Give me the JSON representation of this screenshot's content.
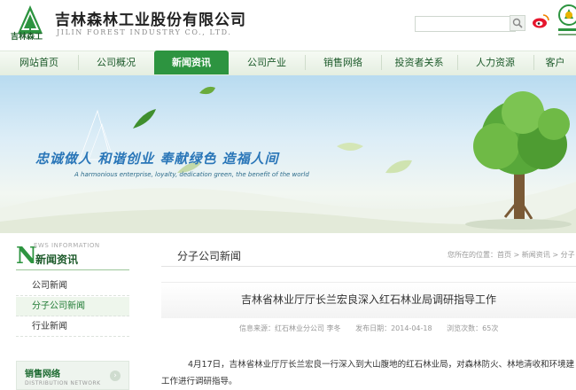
{
  "header": {
    "logo_caption": "吉林森工",
    "company_cn": "吉林森林工业股份有限公司",
    "company_en": "JILIN FOREST INDUSTRY CO., LTD.",
    "search_placeholder": ""
  },
  "nav": {
    "items": [
      {
        "label": "网站首页"
      },
      {
        "label": "公司概况"
      },
      {
        "label": "新闻资讯"
      },
      {
        "label": "公司产业"
      },
      {
        "label": "销售网络"
      },
      {
        "label": "投资者关系"
      },
      {
        "label": "人力资源"
      },
      {
        "label": "客户"
      }
    ],
    "active_index": 2
  },
  "banner": {
    "slogan_cn": "忠诚做人   和谐创业   奉献绿色   造福人间",
    "slogan_en": "A harmonious enterprise, loyalty, dedication green, the benefit of the world"
  },
  "sidebar": {
    "head_letter": "N",
    "head_en": "EWS INFORMATION",
    "title": "新闻资讯",
    "items": [
      {
        "label": "公司新闻"
      },
      {
        "label": "分子公司新闻"
      },
      {
        "label": "行业新闻"
      }
    ],
    "active_index": 1,
    "sales_cn": "销售网络",
    "sales_en": "DISTRIBUTION NETWORK"
  },
  "content": {
    "section_title": "分子公司新闻",
    "breadcrumb": "您所在的位置：首页 > 新闻资讯 > 分子",
    "article_title": "吉林省林业厅厅长兰宏良深入红石林业局调研指导工作",
    "meta": {
      "source": "信息来源：红石林业分公司 李冬",
      "date": "发布日期：2014-04-18",
      "views": "浏览次数：65次"
    },
    "para_line1": "4月17日，吉林省林业厅厅长兰宏良一行深入到大山腹地的红石林业局，对森林防火、林地清收和环境建",
    "para_line2": "工作进行调研指导。"
  },
  "colors": {
    "brand_green": "#2d9440",
    "slogan_blue": "#2a76b8"
  }
}
